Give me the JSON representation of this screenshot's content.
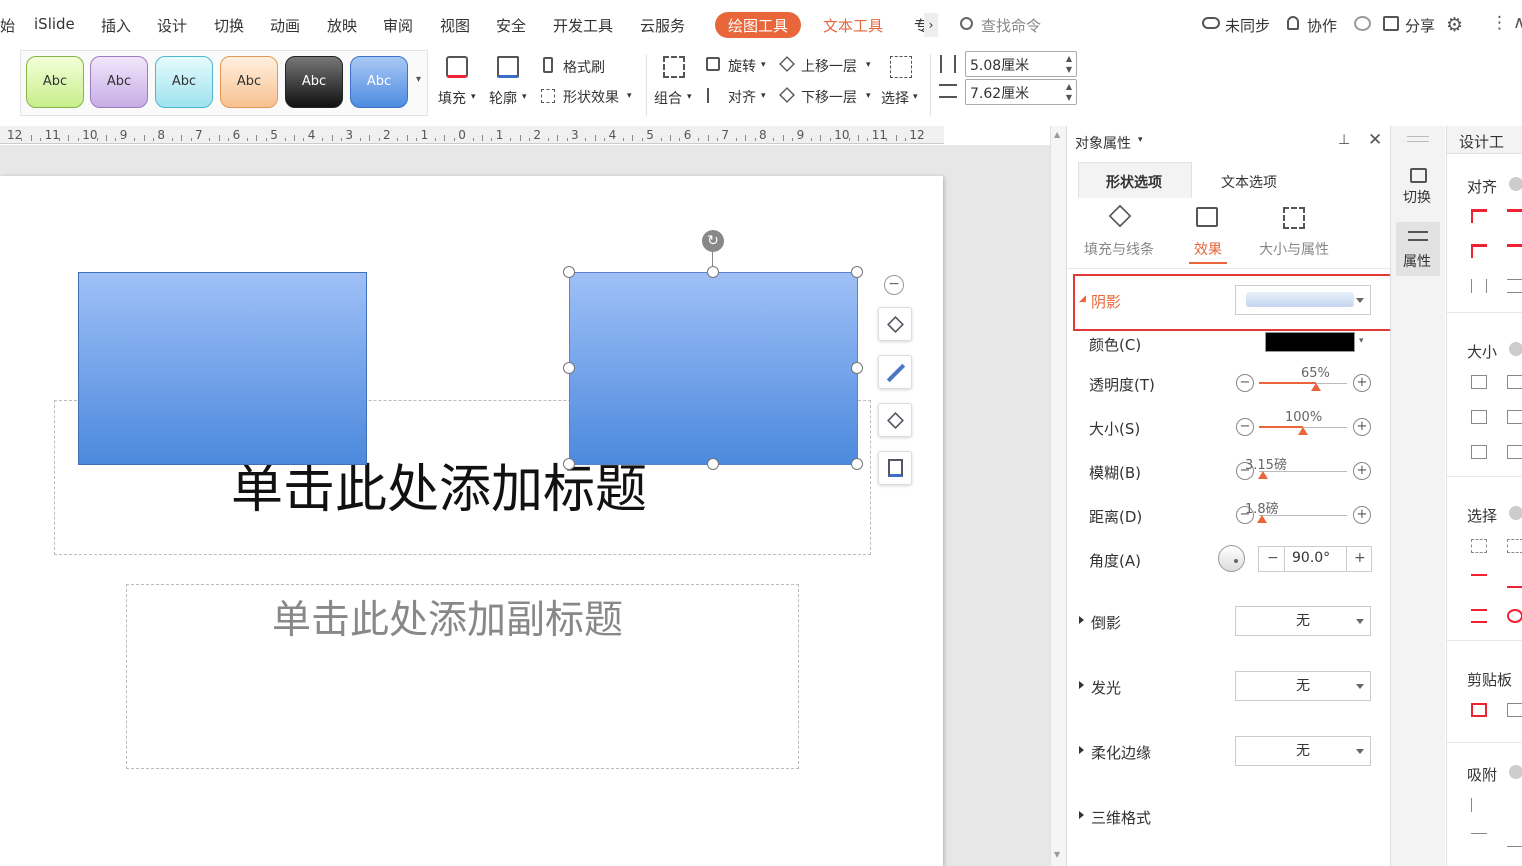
{
  "menubar": {
    "items": [
      "始",
      "iSlide",
      "插入",
      "设计",
      "切换",
      "动画",
      "放映",
      "审阅",
      "视图",
      "安全",
      "开发工具",
      "云服务"
    ],
    "active_tab": "绘图工具",
    "text_tools": "文本工具",
    "more": "专",
    "search_placeholder": "查找命令",
    "sync": "未同步",
    "collab": "协作",
    "share": "分享"
  },
  "ribbon": {
    "style_label": "Abc",
    "fill": "填充",
    "outline": "轮廓",
    "format_painter": "格式刷",
    "shape_effect": "形状效果",
    "group": "组合",
    "rotate": "旋转",
    "align": "对齐",
    "bring_forward": "上移一层",
    "send_backward": "下移一层",
    "select": "选择",
    "height": "5.08厘米",
    "width": "7.62厘米"
  },
  "ruler": {
    "ticks": [
      "12",
      "11",
      "10",
      "9",
      "8",
      "7",
      "6",
      "5",
      "4",
      "3",
      "2",
      "1",
      "0",
      "1",
      "2",
      "3",
      "4",
      "5",
      "6",
      "7",
      "8",
      "9",
      "10",
      "11",
      "12"
    ]
  },
  "slide": {
    "title_placeholder": "单击此处添加标题",
    "subtitle_placeholder": "单击此处添加副标题"
  },
  "panel": {
    "title": "对象属性",
    "tab_shape": "形状选项",
    "tab_text": "文本选项",
    "sub_fill": "填充与线条",
    "sub_effect": "效果",
    "sub_size": "大小与属性",
    "shadow": "阴影",
    "color": "颜色(C)",
    "transparency": "透明度(T)",
    "transparency_val": "65%",
    "size": "大小(S)",
    "size_val": "100%",
    "blur": "模糊(B)",
    "blur_val": "3.15磅",
    "distance": "距离(D)",
    "distance_val": "1.8磅",
    "angle": "角度(A)",
    "angle_val": "90.0°",
    "reflection": "倒影",
    "reflection_val": "无",
    "glow": "发光",
    "glow_val": "无",
    "soft_edges": "柔化边缘",
    "soft_edges_val": "无",
    "threed": "三维格式"
  },
  "sidebar": {
    "switch": "切换",
    "properties": "属性"
  },
  "far_panel": {
    "title": "设计工",
    "align": "对齐",
    "size": "大小",
    "select": "选择",
    "clipboard": "剪贴板",
    "snap": "吸附"
  },
  "colors": {
    "accent": "#e8663a",
    "highlight_box": "#e53935",
    "shape_top": "#9fc0f7",
    "shape_bottom": "#4c89dd"
  }
}
